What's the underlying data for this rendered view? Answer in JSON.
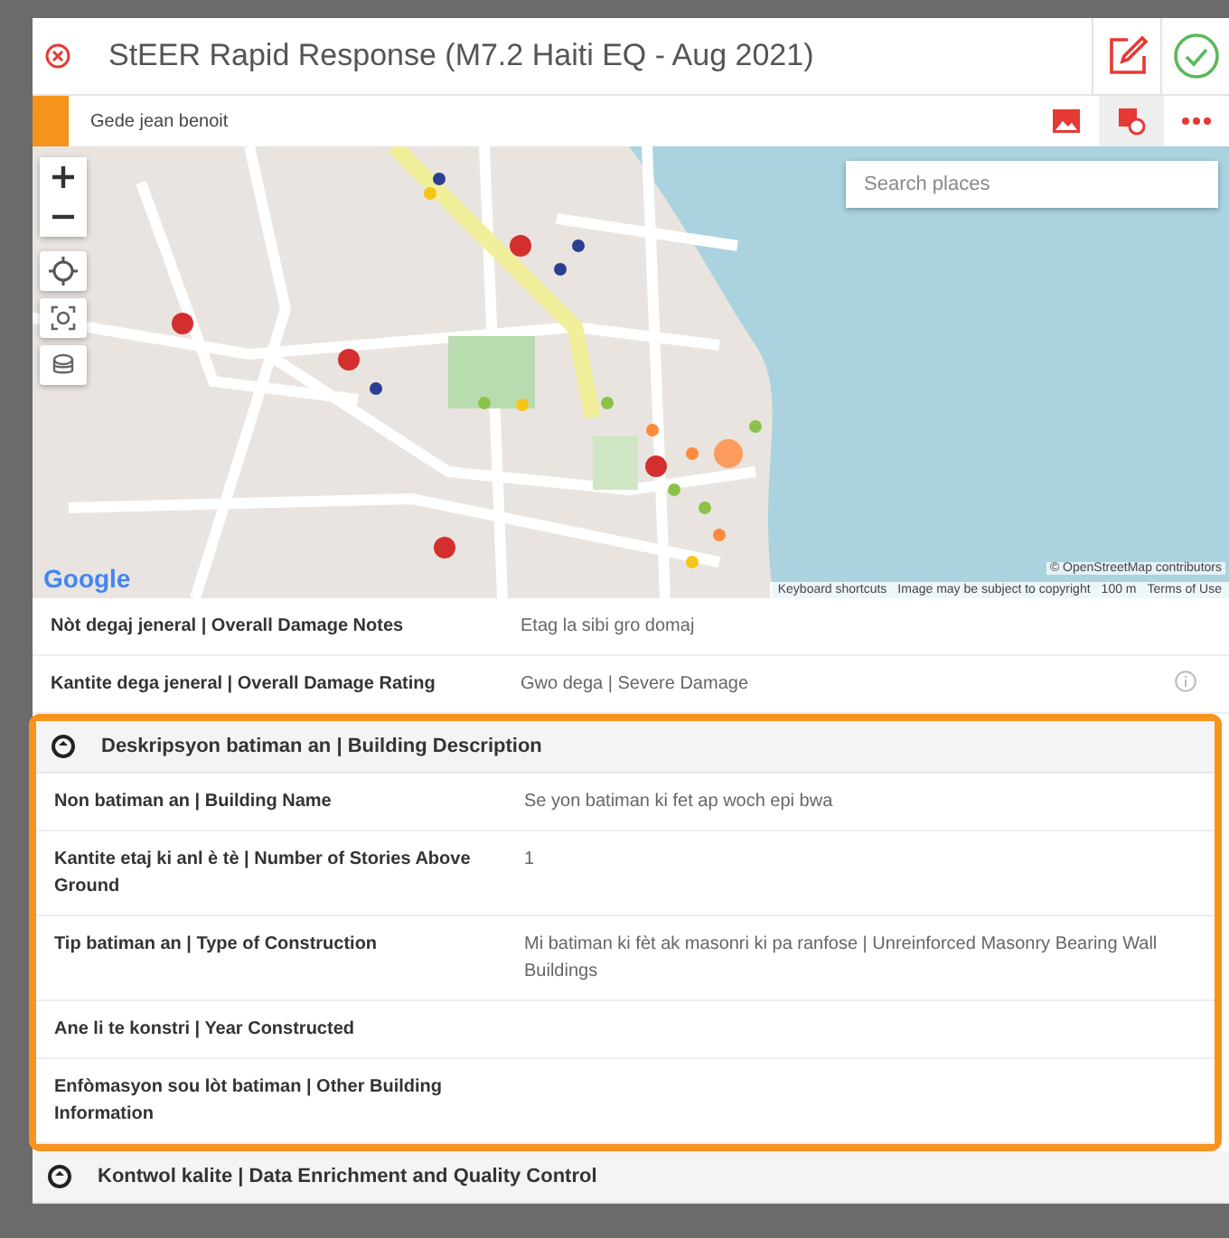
{
  "dialog": {
    "title": "StEER Rapid Response (M7.2 Haiti EQ - Aug 2021)",
    "subtitle": "Gede jean benoit"
  },
  "map": {
    "search": {
      "placeholder": "Search places"
    },
    "logo": "Google",
    "attribution": "© OpenStreetMap contributors",
    "footer": [
      "Keyboard shortcuts",
      "Image may be subject to copyright",
      "100 m",
      "Terms of Use"
    ]
  },
  "fields": [
    {
      "label": "Nòt degaj jeneral | Overall Damage Notes",
      "value": "Etag la sibi gro domaj",
      "info": false
    },
    {
      "label": "Kantite dega jeneral | Overall Damage Rating",
      "value": "Gwo dega | Severe Damage",
      "info": true
    }
  ],
  "sections": [
    {
      "title": "Deskripsyon batiman an | Building Description",
      "highlighted": true,
      "fields": [
        {
          "label": "Non batiman an | Building Name",
          "value": "Se yon batiman ki fet ap woch epi bwa"
        },
        {
          "label": "Kantite etaj ki anl è tè | Number of Stories Above Ground",
          "value": "1"
        },
        {
          "label": "Tip batiman an | Type of Construction",
          "value": "Mi batiman ki fèt ak masonri ki pa ranfose | Unreinforced Masonry Bearing Wall Buildings"
        },
        {
          "label": "Ane li te konstri | Year Constructed"
        },
        {
          "label": "Enfòmasyon sou lòt batiman | Other Building Information"
        }
      ]
    },
    {
      "title": "Kontwol kalite | Data Enrichment and Quality Control",
      "highlighted": false
    }
  ]
}
